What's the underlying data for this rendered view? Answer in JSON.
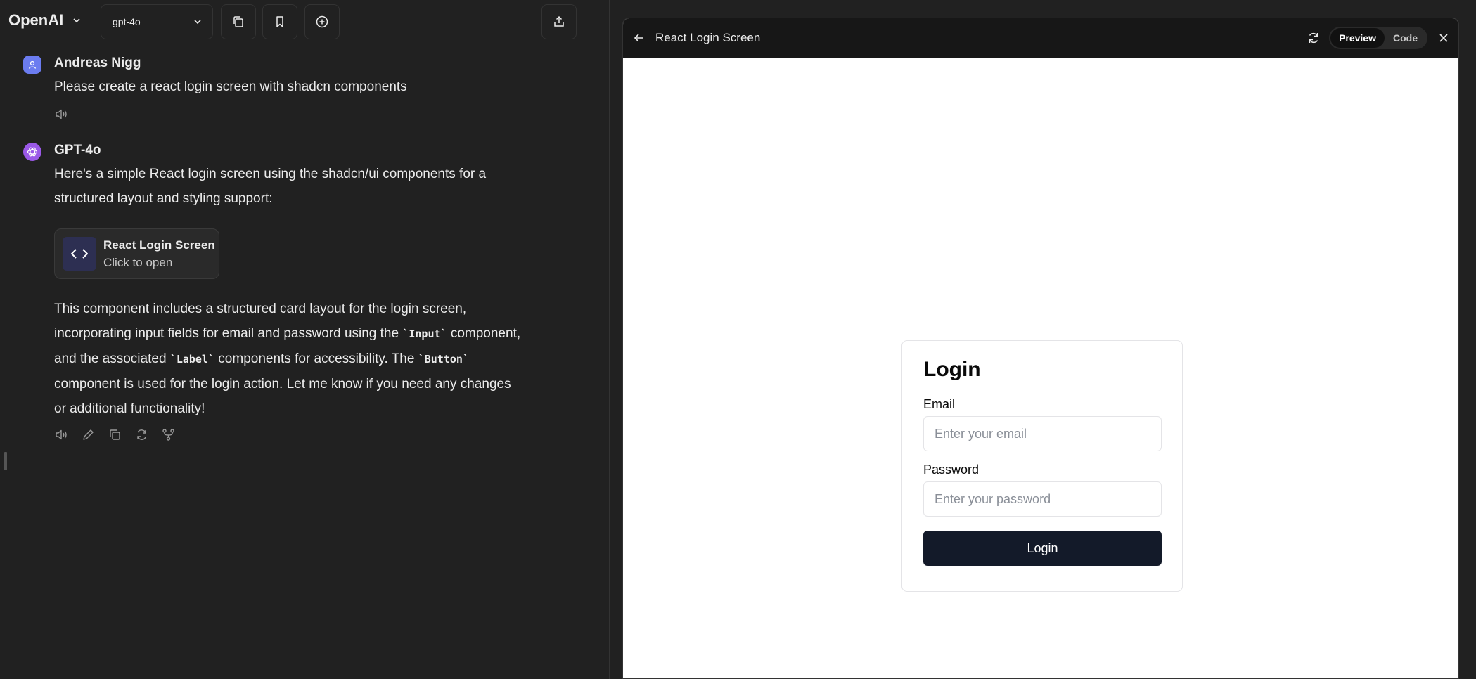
{
  "header": {
    "brand": "OpenAI",
    "model": "gpt-4o"
  },
  "messages": [
    {
      "author": "Andreas Nigg",
      "text": "Please create a react login screen with shadcn components"
    },
    {
      "author": "GPT-4o",
      "text_lines": [
        "Here's a simple React login screen using the shadcn/ui components for a",
        "structured layout and styling support:"
      ],
      "artifact": {
        "title": "React Login Screen",
        "subtitle": "Click to open"
      },
      "body": {
        "l1": "This component includes a structured card layout for the login screen,",
        "l2a": "incorporating input fields for email and password using the ",
        "code1": "`Input`",
        "l2b": " component,",
        "l3a": "and the associated ",
        "code2": "`Label`",
        "l3b": " components for accessibility. The ",
        "code3": "`Button`",
        "l4": "component is used for the login action. Let me know if you need any changes",
        "l5": "or additional functionality!"
      }
    }
  ],
  "panel": {
    "title": "React Login Screen",
    "tabs": [
      "Preview",
      "Code"
    ],
    "active_tab": "Preview"
  },
  "login": {
    "title": "Login",
    "email_label": "Email",
    "email_placeholder": "Enter your email",
    "password_label": "Password",
    "password_placeholder": "Enter your password",
    "button": "Login"
  }
}
